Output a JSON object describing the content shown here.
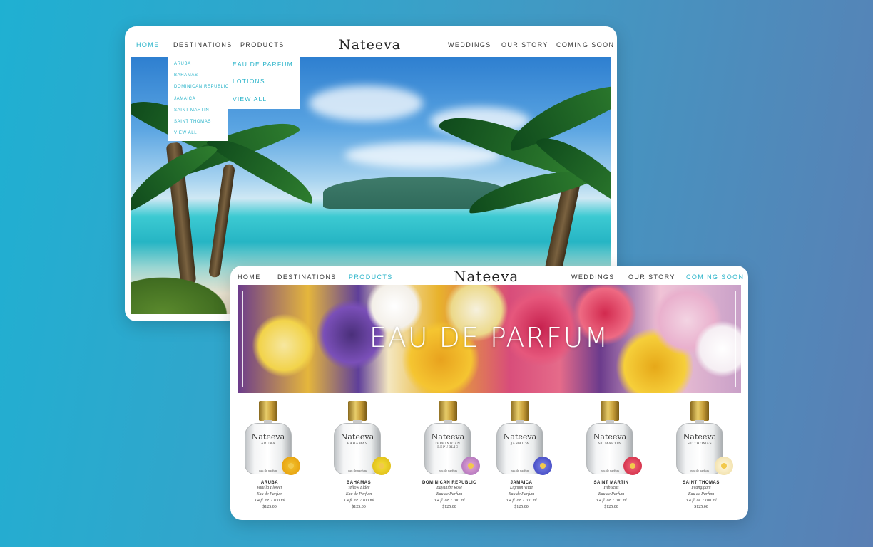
{
  "back_card": {
    "nav_left": [
      "HOME",
      "DESTINATIONS",
      "PRODUCTS"
    ],
    "logo": "Nateeva",
    "nav_right": [
      "WEDDINGS",
      "OUR STORY",
      "COMING SOON"
    ],
    "destinations_menu": [
      "ARUBA",
      "BAHAMAS",
      "DOMINICAN REPUBLIC",
      "JAMAICA",
      "SAINT MARTIN",
      "SAINT THOMAS",
      "VIEW ALL"
    ],
    "products_menu": [
      "EAU DE PARFUM",
      "LOTIONS",
      "VIEW ALL"
    ]
  },
  "front_card": {
    "nav_left": [
      "HOME",
      "DESTINATIONS",
      "PRODUCTS"
    ],
    "logo": "Nateeva",
    "nav_right": [
      "WEDDINGS",
      "OUR STORY",
      "COMING SOON"
    ],
    "banner_title": "EAU DE PARFUM",
    "products": [
      {
        "bottle_label": "ARUBA",
        "name": "ARUBA",
        "scent": "Vanilla Flower",
        "type": "Eau de Parfum",
        "size": "3.4 fl. oz. / 100 ml",
        "price": "$125.00",
        "bottle_sub": "eau de parfum"
      },
      {
        "bottle_label": "BAHAMAS",
        "name": "BAHAMAS",
        "scent": "Yellow Elder",
        "type": "Eau de Parfum",
        "size": "3.4 fl. oz. / 100 ml",
        "price": "$125.00",
        "bottle_sub": "eau de parfum"
      },
      {
        "bottle_label": "DOMINICAN REPUBLIC",
        "name": "DOMINICAN REPUBLIC",
        "scent": "Bayahibe Rose",
        "type": "Eau de Parfum",
        "size": "3.4 fl. oz. / 100 ml",
        "price": "$125.00",
        "bottle_sub": "eau de parfum"
      },
      {
        "bottle_label": "JAMAICA",
        "name": "JAMAICA",
        "scent": "Lignum Vitae",
        "type": "Eau de Parfum",
        "size": "3.4 fl. oz. / 100 ml",
        "price": "$125.00",
        "bottle_sub": "eau de parfum"
      },
      {
        "bottle_label": "ST MARTIN",
        "name": "SAINT MARTIN",
        "scent": "Hibiscus",
        "type": "Eau de Parfum",
        "size": "3.4 fl. oz. / 100 ml",
        "price": "$125.00",
        "bottle_sub": "eau de parfum"
      },
      {
        "bottle_label": "ST THOMAS",
        "name": "SAINT THOMAS",
        "scent": "Frangipani",
        "type": "Eau de Parfum",
        "size": "3.4 fl. oz. / 100 ml",
        "price": "$125.00",
        "bottle_sub": "eau de parfum"
      }
    ]
  },
  "colors": {
    "accent": "#28b3c9",
    "nav_text": "#333333",
    "background_start": "#1fb0d2",
    "background_end": "#5a7fb4"
  }
}
